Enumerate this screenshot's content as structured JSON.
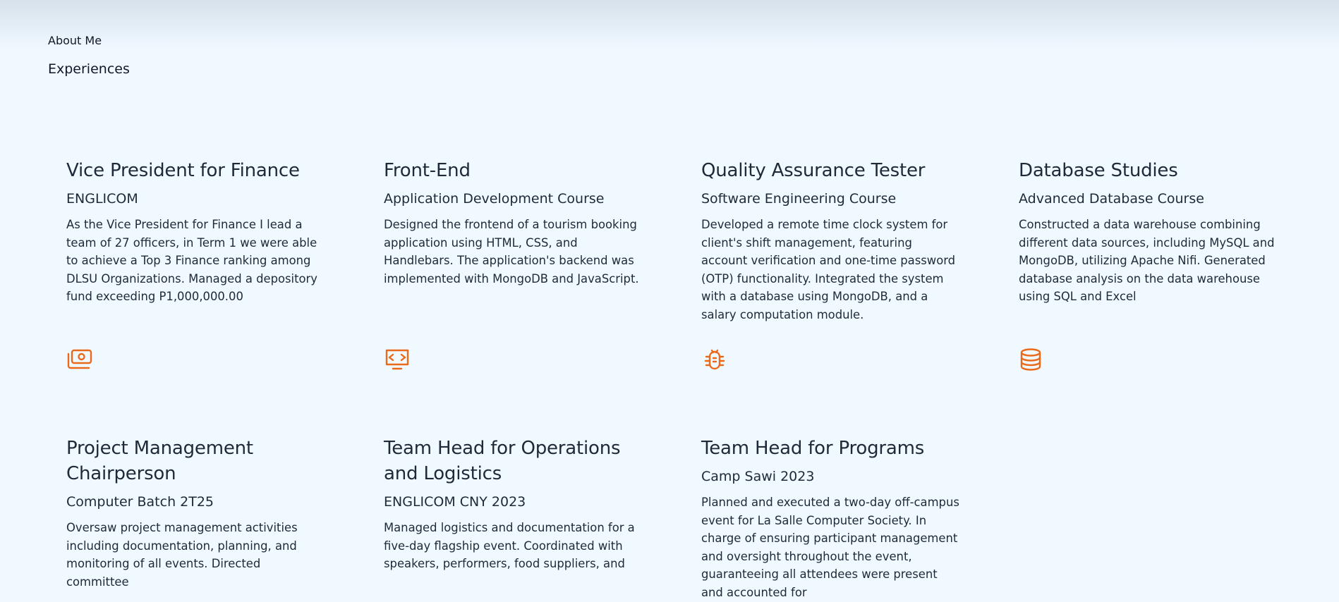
{
  "nav": {
    "about_label": "About Me",
    "experiences_label": "Experiences"
  },
  "accent_color": "#ea6a1c",
  "experiences": [
    {
      "title": "Vice President for Finance",
      "org": "ENGLICOM",
      "description": "As the Vice President for Finance I lead a team of 27 officers, in Term 1 we were able to achieve a Top 3 Finance ranking among DLSU Organizations. Managed a depository fund exceeding P1,000,000.00",
      "icon": "money-icon"
    },
    {
      "title": "Front-End",
      "org": "Application Development Course",
      "description": "Designed the frontend of a tourism booking application using HTML, CSS, and Handlebars. The application's backend was implemented with MongoDB and JavaScript.",
      "icon": "code-monitor-icon"
    },
    {
      "title": "Quality Assurance Tester",
      "org": "Software Engineering Course",
      "description": "Developed a remote time clock system for client's shift management, featuring account verification and one-time password (OTP) functionality. Integrated the system with a database using MongoDB, and a salary computation module.",
      "icon": "bug-icon"
    },
    {
      "title": "Database Studies",
      "org": "Advanced Database Course",
      "description": "Constructed a data warehouse combining different data sources, including MySQL and MongoDB, utilizing Apache Nifi. Generated database analysis on the data warehouse using SQL and Excel",
      "icon": "database-icon"
    },
    {
      "title": "Project Management Chairperson",
      "org": "Computer Batch 2T25",
      "description": "Oversaw project management activities including documentation, planning, and monitoring of all events. Directed committee"
    },
    {
      "title": "Team Head for Operations and Logistics",
      "org": "ENGLICOM CNY 2023",
      "description": "Managed logistics and documentation for a five-day flagship event. Coordinated with speakers, performers, food suppliers, and"
    },
    {
      "title": "Team Head for Programs",
      "org": "Camp Sawi 2023",
      "description": "Planned and executed a two-day off-campus event for La Salle Computer Society. In charge of ensuring participant management and oversight throughout the event, guaranteeing all attendees were present and accounted for"
    }
  ]
}
